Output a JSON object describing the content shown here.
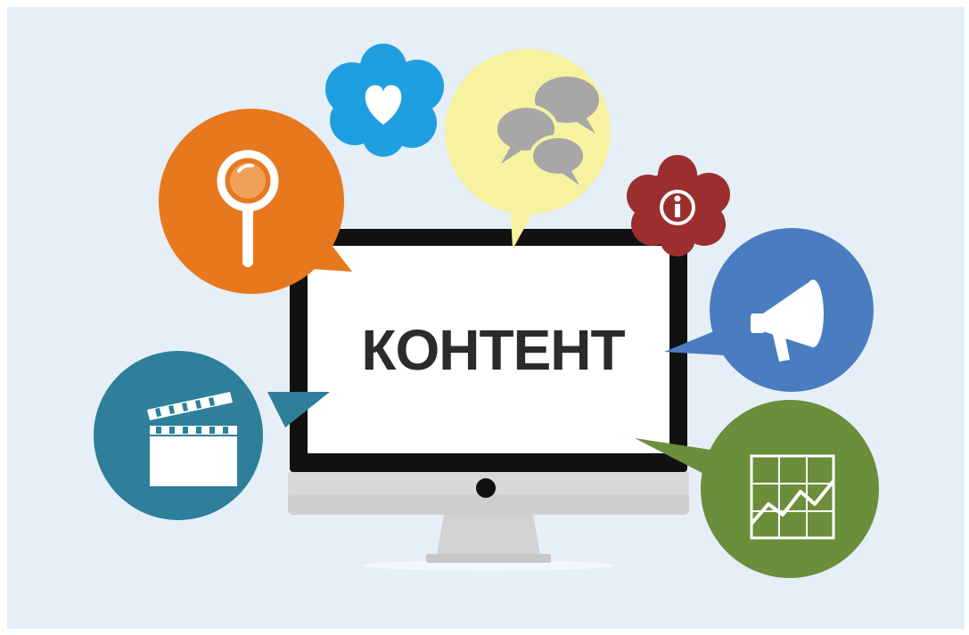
{
  "illustration": {
    "screen_text": "КОНТЕНТ"
  },
  "bubbles": {
    "search": {
      "icon": "magnifier-icon",
      "color": "#e8781d"
    },
    "favorite": {
      "icon": "heart-icon",
      "color": "#1f9fe0"
    },
    "comments": {
      "icon": "chat-bubbles-icon",
      "color": "#f6f2a0"
    },
    "info": {
      "icon": "info-icon",
      "color": "#9b2f2f"
    },
    "announce": {
      "icon": "megaphone-icon",
      "color": "#4a7cc0"
    },
    "video": {
      "icon": "clapperboard-icon",
      "color": "#2d7f9a"
    },
    "analytics": {
      "icon": "line-chart-icon",
      "color": "#6b8e3a"
    }
  },
  "colors": {
    "background": "#e6eef8",
    "monitor_bezel": "#111111",
    "monitor_screen": "#ffffff",
    "monitor_base": "#d9d9d9"
  }
}
